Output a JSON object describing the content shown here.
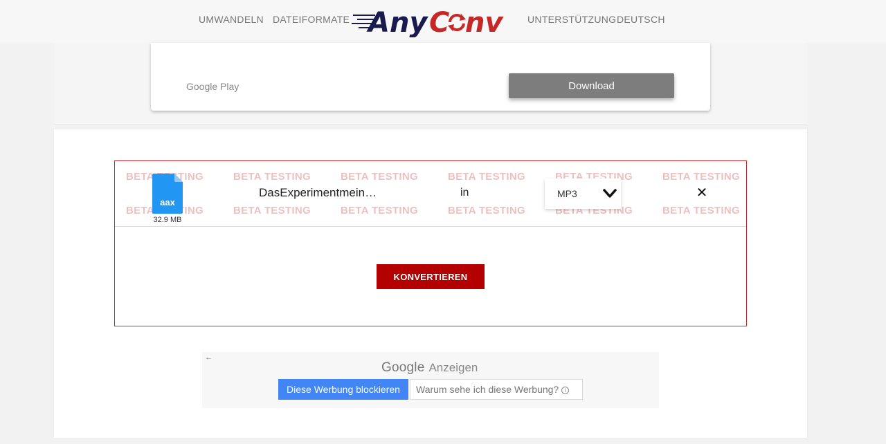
{
  "nav": {
    "left": [
      "UMWANDELN",
      "DATEIFORMATE"
    ],
    "right": [
      "UNTERSTÜTZUNG",
      "DEUTSCH"
    ]
  },
  "logo": {
    "text_part1": "Any",
    "text_part2": "C",
    "text_part3": "nv",
    "color_dark": "#1a1a4e",
    "color_red": "#c62828"
  },
  "app_card": {
    "store_label": "Google Play",
    "download_label": "Download"
  },
  "watermark": "BETA TESTING",
  "file": {
    "extension": "aax",
    "size": "32.9 MB",
    "name": "DasExperimentmeinA…",
    "in_label": "in",
    "target_format": "MP3",
    "icon_color": "#2196f3"
  },
  "convert_button": "KONVERTIEREN",
  "ad": {
    "brand": "Google",
    "label": "Anzeigen",
    "block_label": "Diese Werbung blockieren",
    "why_label": "Warum sehe ich diese Werbung?"
  },
  "colors": {
    "accent_red": "#b30000",
    "border_red": "#c62828",
    "google_blue": "#4285f4"
  }
}
